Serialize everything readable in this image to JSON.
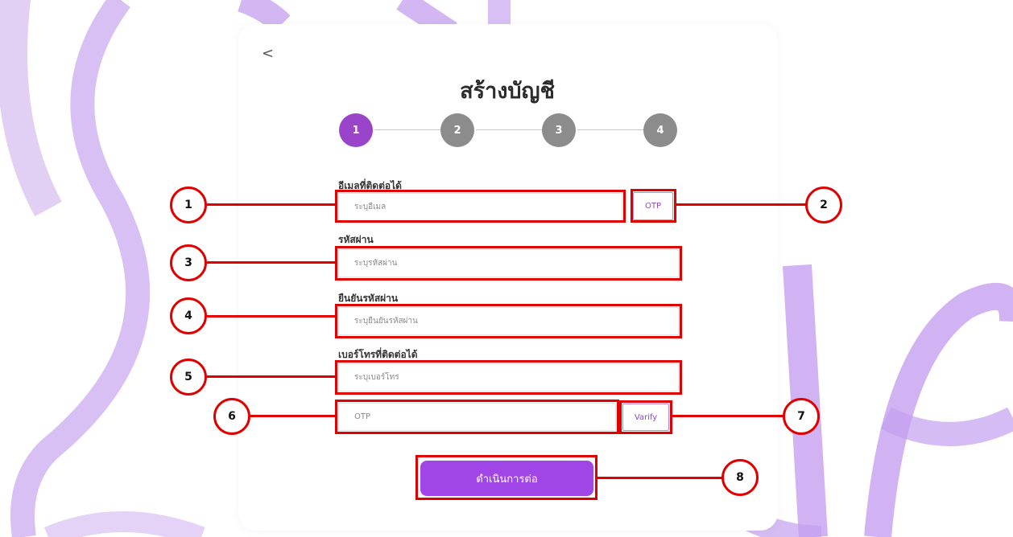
{
  "page": {
    "back_icon": "<",
    "title": "สร้างบัญชี"
  },
  "steps": [
    "1",
    "2",
    "3",
    "4"
  ],
  "form": {
    "email": {
      "label": "อีเมลที่ติดต่อได้",
      "placeholder": "ระบุอีเมล",
      "otp_button": "OTP"
    },
    "password": {
      "label": "รหัสผ่าน",
      "placeholder": "ระบุรหัสผ่าน"
    },
    "confirm_password": {
      "label": "ยืนยันรหัสผ่าน",
      "placeholder": "ระบุยืนยันรหัสผ่าน"
    },
    "phone": {
      "label": "เบอร์โทรที่ติดต่อได้",
      "placeholder": "ระบุเบอร์โทร"
    },
    "otp": {
      "placeholder": "OTP",
      "verify_button": "Varify"
    }
  },
  "continue_button": "ดำเนินการต่อ",
  "callouts": [
    "1",
    "2",
    "3",
    "4",
    "5",
    "6",
    "7",
    "8"
  ],
  "colors": {
    "accent": "#a046e6",
    "step_active": "#9a45c9",
    "step_inactive": "#8c8c8c",
    "annotation": "#e00000"
  }
}
